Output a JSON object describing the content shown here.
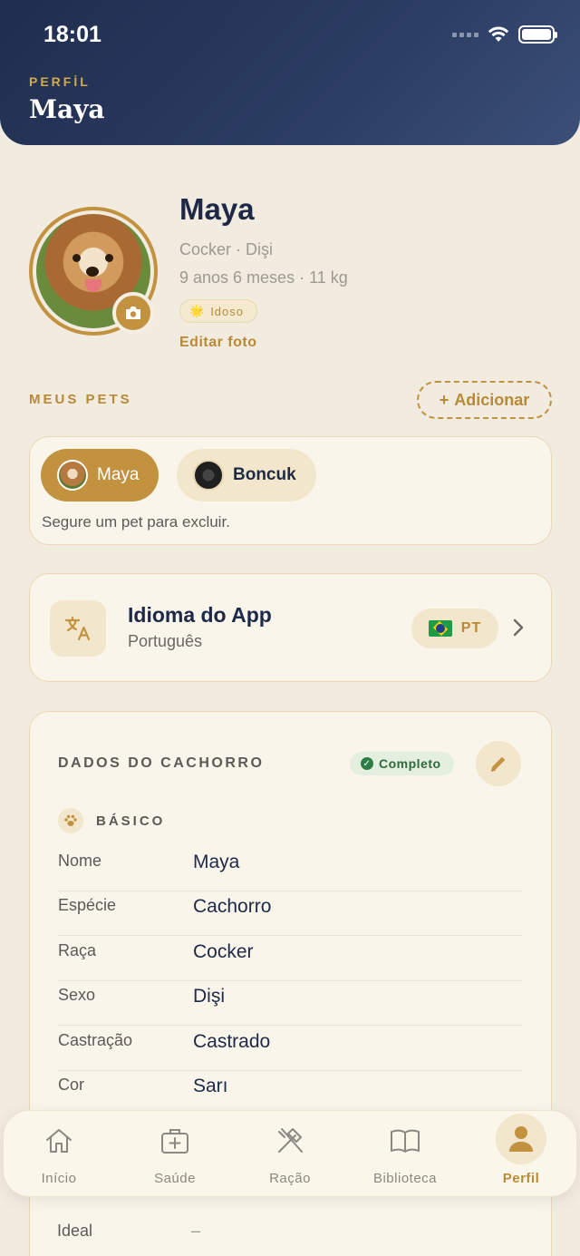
{
  "status_bar": {
    "time": "18:01"
  },
  "header": {
    "kicker": "PERFİL",
    "title": "Maya"
  },
  "profile": {
    "name": "Maya",
    "breed_line": "Cocker · Dişi",
    "age_line": "9 anos 6 meses · 11 kg",
    "badge": "Idoso",
    "edit_photo": "Editar foto"
  },
  "pets_section": {
    "label": "MEUS PETS",
    "add_button": "Adicionar",
    "pets": [
      {
        "name": "Maya",
        "active": true
      },
      {
        "name": "Boncuk",
        "active": false
      }
    ],
    "hint": "Segure um pet para excluir."
  },
  "language": {
    "title": "Idioma do App",
    "current": "Português",
    "code": "PT"
  },
  "dog_data": {
    "title": "DADOS DO CACHORRO",
    "status": "Completo",
    "section": "BÁSICO",
    "fields": [
      {
        "key": "Nome",
        "value": "Maya"
      },
      {
        "key": "Espécie",
        "value": "Cachorro"
      },
      {
        "key": "Raça",
        "value": "Cocker"
      },
      {
        "key": "Sexo",
        "value": "Dişi"
      },
      {
        "key": "Castração",
        "value": "Castrado"
      },
      {
        "key": "Cor",
        "value": "Sarı"
      }
    ],
    "ideal": {
      "key": "Ideal",
      "value": "–"
    }
  },
  "tabbar": {
    "tabs": [
      {
        "label": "Início",
        "icon": "home-icon"
      },
      {
        "label": "Saúde",
        "icon": "medical-kit-icon"
      },
      {
        "label": "Ração",
        "icon": "utensils-icon"
      },
      {
        "label": "Biblioteca",
        "icon": "book-icon"
      },
      {
        "label": "Perfil",
        "icon": "user-icon",
        "active": true
      }
    ]
  },
  "colors": {
    "accent": "#c2923f",
    "navy": "#1f2d4f",
    "success": "#2e7d44"
  }
}
